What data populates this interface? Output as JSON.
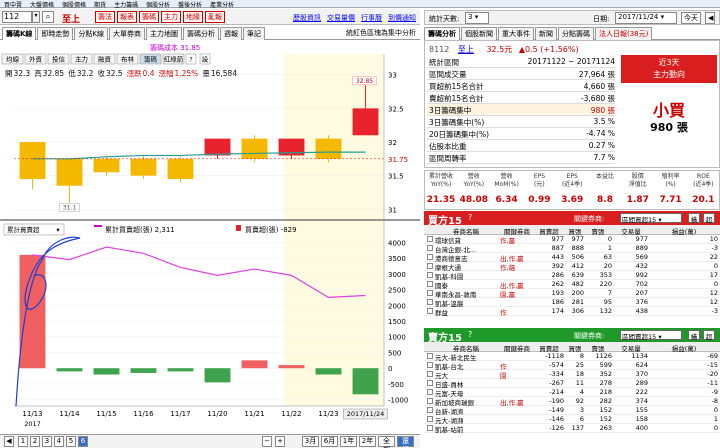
{
  "menu": [
    "買中賣",
    "大盤價格",
    "個股價格",
    "期貨",
    "主力籌碼",
    "個股分析",
    "盤後分析",
    "產業分析"
  ],
  "symbol": {
    "code": "112",
    "name": "至上"
  },
  "red_buttons": [
    "籌法",
    "報表",
    "籌碼",
    "主力",
    "地緣",
    "亂報"
  ],
  "top_links": [
    "歷股資訊",
    "交易量價",
    "行事曆",
    "到價通知"
  ],
  "left_tabs": [
    "籌碼K線",
    "即時走勢",
    "分點K線",
    "大單券商",
    "主力地圖",
    "籌碼分析",
    "週報",
    "筆記"
  ],
  "left_tab_note": "統紅色區塊為集中分析",
  "chart": {
    "legend_main": "籌碼成本 31.85",
    "sub_tabs": [
      "均線",
      "外資",
      "投信",
      "主力",
      "融資",
      "布林",
      "籌碼",
      "紅綠箭"
    ],
    "sub_tab_btn": "?",
    "sub_tab_btn2": "設",
    "quote": {
      "open_label": "開",
      "open": "32.3",
      "high_label": "高",
      "high": "32.85",
      "low_label": "低",
      "low": "32.2",
      "close_label": "收",
      "close": "32.5",
      "chg_label": "漲跌",
      "chg": "0.4",
      "pct_label": "漲幅",
      "pct": "1.25%",
      "vol_label": "量",
      "vol": "16,584"
    },
    "price_tag_high": "32.85",
    "price_tag_low": "31.1",
    "price_current": "31.75",
    "price_ticks": [
      "33",
      "32.5",
      "32",
      "31.5",
      "31"
    ],
    "sub_select": "累計買賣超",
    "sub_legend1": "累計買賣超(張) 2,311",
    "sub_legend2": "買賣超(張) -829",
    "sub_ticks": [
      "4000",
      "3500",
      "3000",
      "2500",
      "2000",
      "1500",
      "1000",
      "500",
      "0",
      "-500",
      "-1000"
    ],
    "x_labels": [
      "11/13",
      "11/14",
      "11/15",
      "11/16",
      "11/17",
      "11/20",
      "11/21",
      "11/22",
      "11/23"
    ],
    "x_current_label": "2017/11/24",
    "x_year": "2017"
  },
  "chart_data": {
    "type": "bar",
    "categories": [
      "11/13",
      "11/14",
      "11/15",
      "11/16",
      "11/17",
      "11/20",
      "11/21",
      "11/22",
      "11/23",
      "11/24"
    ],
    "candles": [
      {
        "open": 32.0,
        "close": 31.45,
        "high": 32.0,
        "low": 31.3,
        "up": false
      },
      {
        "open": 31.75,
        "close": 31.35,
        "high": 31.75,
        "low": 31.1,
        "up": false
      },
      {
        "open": 31.75,
        "close": 31.55,
        "high": 31.8,
        "low": 31.5,
        "up": false
      },
      {
        "open": 31.75,
        "close": 31.5,
        "high": 31.8,
        "low": 31.45,
        "up": false
      },
      {
        "open": 31.75,
        "close": 31.45,
        "high": 31.8,
        "low": 31.4,
        "up": false
      },
      {
        "open": 31.8,
        "close": 32.05,
        "high": 32.05,
        "low": 31.75,
        "up": true
      },
      {
        "open": 32.05,
        "close": 31.75,
        "high": 32.1,
        "low": 31.7,
        "up": false
      },
      {
        "open": 31.8,
        "close": 32.05,
        "high": 32.05,
        "low": 31.75,
        "up": true
      },
      {
        "open": 32.05,
        "close": 31.75,
        "high": 32.1,
        "low": 31.7,
        "up": false
      },
      {
        "open": 32.1,
        "close": 32.5,
        "high": 32.85,
        "low": 32.1,
        "up": true
      }
    ],
    "cost_line": [
      31.75,
      31.75,
      31.78,
      31.8,
      31.8,
      31.82,
      31.83,
      31.84,
      31.85,
      31.85
    ],
    "net_bs": [
      3600,
      -100,
      -200,
      -150,
      -100,
      -450,
      250,
      100,
      -200,
      -829
    ],
    "cum_bs": [
      3600,
      3450,
      3850,
      3650,
      3200,
      2950,
      3150,
      2950,
      2250,
      2311
    ],
    "ylim_price": [
      30.9,
      33.1
    ],
    "ylim_sub": [
      -1200,
      4200
    ]
  },
  "right_top": {
    "label": "統計天數:",
    "days": "3",
    "date_label": "日期:",
    "date": "2017/11/24",
    "btn_today": "今天",
    "btn_prev": "◀",
    "btn_next": "▶"
  },
  "right_tabs": [
    "籌碼分析",
    "個股新聞",
    "重大事件",
    "新聞",
    "分點籌碼",
    "法人日報(38元)"
  ],
  "info": {
    "code": "8112",
    "name": "至上",
    "price": "32.5元",
    "change": "▲0.5 (+1.56%)",
    "rows": [
      {
        "label": "統計區間",
        "value": "20171122 ~ 20171124"
      },
      {
        "label": "區間成交量",
        "value": "27,964 張"
      },
      {
        "label": "買超前15名合計",
        "value": "4,660 張"
      },
      {
        "label": "賣超前15名合計",
        "value": "-3,680 張"
      },
      {
        "label": "3日籌碼集中",
        "value": "980 張"
      },
      {
        "label": "3日籌碼集中(%)",
        "value": "3.5 %"
      },
      {
        "label": "20日籌碼集中(%)",
        "value": "-4.74 %"
      },
      {
        "label": "佔股本比重",
        "value": "0.27 %"
      },
      {
        "label": "區間周轉率",
        "value": "7.7 %"
      }
    ],
    "box_title1": "近3天",
    "box_title2": "主力動向",
    "box_big": "小買",
    "box_val": "980 張"
  },
  "metrics": [
    {
      "label": "累計營收\nYoY(%)",
      "value": "21.35"
    },
    {
      "label": "營收\nYoY(%)",
      "value": "48.08"
    },
    {
      "label": "營收\nMoM(%)",
      "value": "6.34"
    },
    {
      "label": "EPS\n(元)",
      "value": "0.99"
    },
    {
      "label": "EPS\n(近4季)",
      "value": "3.69"
    },
    {
      "label": "本益比",
      "value": "8.8"
    },
    {
      "label": "股價\n淨值比",
      "value": "1.87"
    },
    {
      "label": "殖利率\n(%)",
      "value": "7.71"
    },
    {
      "label": "ROE\n(近4季)",
      "value": "20.1"
    }
  ],
  "buy_panel": {
    "title": "買方15",
    "question": "?",
    "label": "關鍵券商:",
    "select": "區間買超15",
    "btn1": "橫",
    "btn2": "超",
    "headers": [
      "券商名稱",
      "關鍵券商",
      "買賣超",
      "買張",
      "賣張",
      "交易量",
      "損益(萬)"
    ],
    "rows": [
      [
        "環球信貸",
        "作,贏",
        "977",
        "977",
        "0",
        "977",
        "10"
      ],
      [
        "台灣企銀-北...",
        "",
        "887",
        "888",
        "1",
        "889",
        "-3"
      ],
      [
        "港商德意志",
        "出,作,贏",
        "443",
        "506",
        "63",
        "569",
        "22"
      ],
      [
        "摩根大通",
        "作,飆",
        "392",
        "412",
        "20",
        "432",
        "0"
      ],
      [
        "凱基-科園",
        "",
        "286",
        "639",
        "353",
        "992",
        "17"
      ],
      [
        "國泰",
        "出,作,贏",
        "262",
        "482",
        "220",
        "702",
        "0"
      ],
      [
        "華南永昌-敦南",
        "園,贏",
        "193",
        "200",
        "7",
        "207",
        "12"
      ],
      [
        "凱基-溫龍",
        "",
        "186",
        "281",
        "95",
        "376",
        "12"
      ],
      [
        "群益",
        "作",
        "174",
        "306",
        "132",
        "438",
        "-3"
      ]
    ]
  },
  "sell_panel": {
    "title": "賣方15",
    "question": "?",
    "label": "關鍵券商:",
    "select": "區間賣超15",
    "btn1": "橫",
    "btn2": "超",
    "headers": [
      "券商名稱",
      "關鍵券商",
      "買賣超",
      "買張",
      "賣張",
      "交易量",
      "損益(萬)"
    ],
    "rows": [
      [
        "元大-新北民生",
        "",
        "-1118",
        "8",
        "1126",
        "1134",
        "-69"
      ],
      [
        "凱基-台北",
        "作",
        "-574",
        "25",
        "599",
        "624",
        "-15"
      ],
      [
        "元大",
        "園",
        "-334",
        "18",
        "352",
        "370",
        "-20"
      ],
      [
        "日盛-員林",
        "",
        "-267",
        "11",
        "278",
        "289",
        "-11"
      ],
      [
        "元富-天母",
        "",
        "-214",
        "4",
        "218",
        "222",
        "-9"
      ],
      [
        "新加坡商瑞銀",
        "出,作,贏",
        "-190",
        "92",
        "282",
        "374",
        "-8"
      ],
      [
        "台新-湖濟",
        "",
        "-149",
        "3",
        "152",
        "155",
        "0"
      ],
      [
        "元大-湖瀕",
        "",
        "-146",
        "6",
        "152",
        "158",
        "1"
      ],
      [
        "凱基-站前",
        "",
        "-126",
        "137",
        "263",
        "400",
        "0"
      ]
    ]
  },
  "bottom": {
    "pages": [
      "1",
      "2",
      "3",
      "4",
      "5",
      "6"
    ],
    "page_sel": "6",
    "periods": [
      "3月",
      "6月",
      "1年",
      "2年",
      "全部",
      "還原"
    ],
    "period_sel": "還原"
  }
}
